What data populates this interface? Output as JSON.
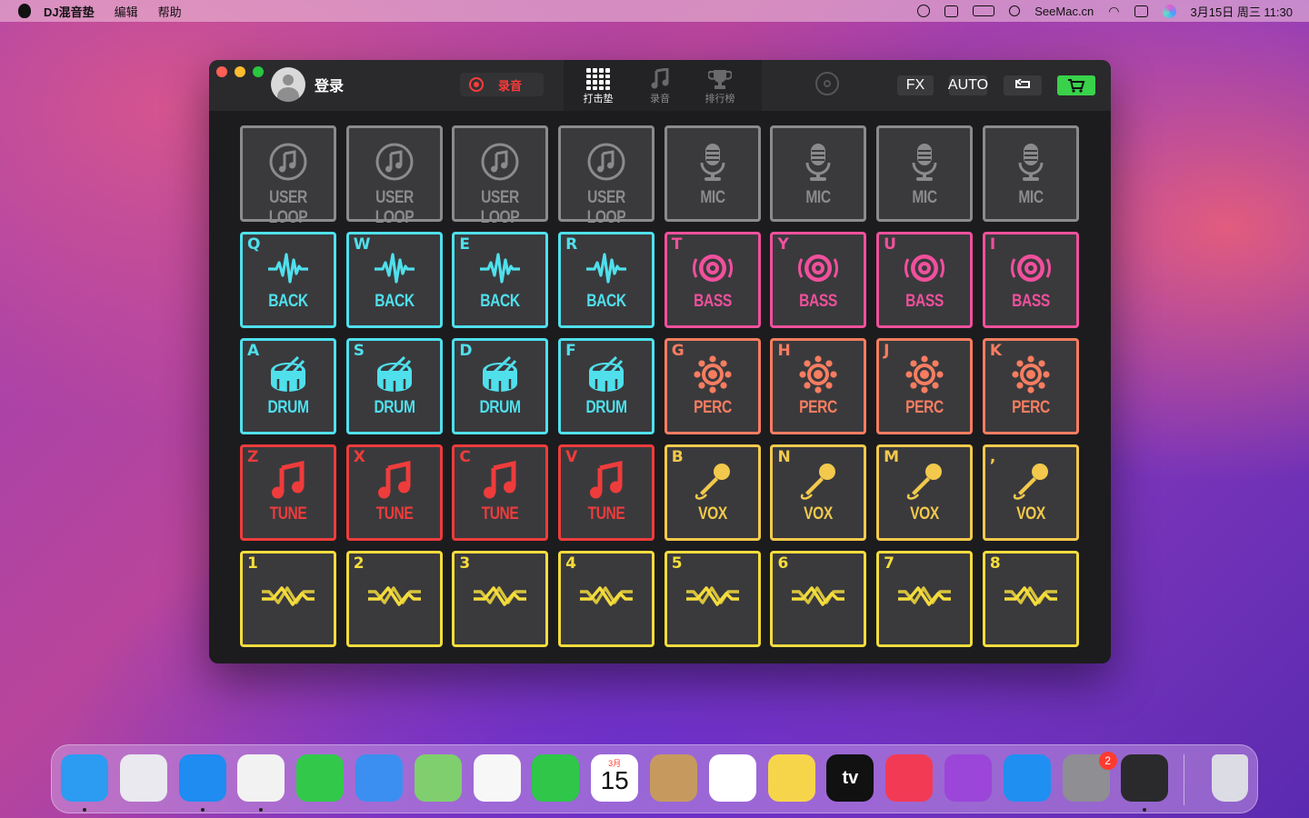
{
  "menubar": {
    "app_name": "DJ混音垫",
    "menus": [
      "编辑",
      "帮助"
    ],
    "site": "SeeMac.cn",
    "datetime": "3月15日 周三  11:30"
  },
  "window": {
    "user_label": "登录",
    "record_label": "录音",
    "tabs": [
      {
        "label": "打击垫",
        "icon": "grid-icon",
        "active": true
      },
      {
        "label": "录音",
        "icon": "music-note-icon",
        "active": false
      },
      {
        "label": "排行榜",
        "icon": "trophy-icon",
        "active": false
      }
    ],
    "fx_label": "FX",
    "auto_label": "AUTO",
    "undo_icon": "undo-icon",
    "cart_icon": "cart-icon"
  },
  "colors": {
    "grey": "#8b8b8e",
    "cyan": "#4fe0ec",
    "pink": "#f0509c",
    "orange": "#f77d60",
    "red": "#ee3c3c",
    "yellow": "#f2c94c",
    "gold": "#f4dc3c"
  },
  "pads": [
    {
      "key": "",
      "label": "USER LOOP",
      "icon": "music-circle-icon",
      "color": "grey"
    },
    {
      "key": "",
      "label": "USER LOOP",
      "icon": "music-circle-icon",
      "color": "grey"
    },
    {
      "key": "",
      "label": "USER LOOP",
      "icon": "music-circle-icon",
      "color": "grey"
    },
    {
      "key": "",
      "label": "USER LOOP",
      "icon": "music-circle-icon",
      "color": "grey"
    },
    {
      "key": "",
      "label": "MIC",
      "icon": "microphone-icon",
      "color": "grey"
    },
    {
      "key": "",
      "label": "MIC",
      "icon": "microphone-icon",
      "color": "grey"
    },
    {
      "key": "",
      "label": "MIC",
      "icon": "microphone-icon",
      "color": "grey"
    },
    {
      "key": "",
      "label": "MIC",
      "icon": "microphone-icon",
      "color": "grey"
    },
    {
      "key": "Q",
      "label": "BACK",
      "icon": "waveform-icon",
      "color": "cyan"
    },
    {
      "key": "W",
      "label": "BACK",
      "icon": "waveform-icon",
      "color": "cyan"
    },
    {
      "key": "E",
      "label": "BACK",
      "icon": "waveform-icon",
      "color": "cyan"
    },
    {
      "key": "R",
      "label": "BACK",
      "icon": "waveform-icon",
      "color": "cyan"
    },
    {
      "key": "T",
      "label": "BASS",
      "icon": "speaker-icon",
      "color": "pink"
    },
    {
      "key": "Y",
      "label": "BASS",
      "icon": "speaker-icon",
      "color": "pink"
    },
    {
      "key": "U",
      "label": "BASS",
      "icon": "speaker-icon",
      "color": "pink"
    },
    {
      "key": "I",
      "label": "BASS",
      "icon": "speaker-icon",
      "color": "pink"
    },
    {
      "key": "A",
      "label": "DRUM",
      "icon": "drum-icon",
      "color": "cyan"
    },
    {
      "key": "S",
      "label": "DRUM",
      "icon": "drum-icon",
      "color": "cyan"
    },
    {
      "key": "D",
      "label": "DRUM",
      "icon": "drum-icon",
      "color": "cyan"
    },
    {
      "key": "F",
      "label": "DRUM",
      "icon": "drum-icon",
      "color": "cyan"
    },
    {
      "key": "G",
      "label": "PERC",
      "icon": "tambourine-icon",
      "color": "orange"
    },
    {
      "key": "H",
      "label": "PERC",
      "icon": "tambourine-icon",
      "color": "orange"
    },
    {
      "key": "J",
      "label": "PERC",
      "icon": "tambourine-icon",
      "color": "orange"
    },
    {
      "key": "K",
      "label": "PERC",
      "icon": "tambourine-icon",
      "color": "orange"
    },
    {
      "key": "Z",
      "label": "TUNE",
      "icon": "music-note-icon",
      "color": "red"
    },
    {
      "key": "X",
      "label": "TUNE",
      "icon": "music-note-icon",
      "color": "red"
    },
    {
      "key": "C",
      "label": "TUNE",
      "icon": "music-note-icon",
      "color": "red"
    },
    {
      "key": "V",
      "label": "TUNE",
      "icon": "music-note-icon",
      "color": "red"
    },
    {
      "key": "B",
      "label": "VOX",
      "icon": "handheld-mic-icon",
      "color": "yellow"
    },
    {
      "key": "N",
      "label": "VOX",
      "icon": "handheld-mic-icon",
      "color": "yellow"
    },
    {
      "key": "M",
      "label": "VOX",
      "icon": "handheld-mic-icon",
      "color": "yellow"
    },
    {
      "key": ",",
      "label": "VOX",
      "icon": "handheld-mic-icon",
      "color": "yellow"
    },
    {
      "key": "1",
      "label": "",
      "icon": "loop-wave-icon",
      "color": "gold"
    },
    {
      "key": "2",
      "label": "",
      "icon": "loop-wave-icon",
      "color": "gold"
    },
    {
      "key": "3",
      "label": "",
      "icon": "loop-wave-icon",
      "color": "gold"
    },
    {
      "key": "4",
      "label": "",
      "icon": "loop-wave-icon",
      "color": "gold"
    },
    {
      "key": "5",
      "label": "",
      "icon": "loop-wave-icon",
      "color": "gold"
    },
    {
      "key": "6",
      "label": "",
      "icon": "loop-wave-icon",
      "color": "gold"
    },
    {
      "key": "7",
      "label": "",
      "icon": "loop-wave-icon",
      "color": "gold"
    },
    {
      "key": "8",
      "label": "",
      "icon": "loop-wave-icon",
      "color": "gold"
    }
  ],
  "dock": {
    "apps": [
      {
        "name": "finder-icon",
        "color": "#2b9cf2",
        "running": true
      },
      {
        "name": "launchpad-icon",
        "color": "#e9e9ef",
        "running": false
      },
      {
        "name": "safari-icon",
        "color": "#1e8cf0",
        "running": true
      },
      {
        "name": "chrome-icon",
        "color": "#f2f2f2",
        "running": true
      },
      {
        "name": "messages-icon",
        "color": "#32c94b",
        "running": false
      },
      {
        "name": "mail-icon",
        "color": "#3b8ff0",
        "running": false
      },
      {
        "name": "maps-icon",
        "color": "#7fcf6e",
        "running": false
      },
      {
        "name": "photos-icon",
        "color": "#f7f7f7",
        "running": false
      },
      {
        "name": "facetime-icon",
        "color": "#2fc64a",
        "running": false
      },
      {
        "name": "calendar-icon",
        "color": "#ffffff",
        "running": false
      },
      {
        "name": "contacts-icon",
        "color": "#c69a5f",
        "running": false
      },
      {
        "name": "reminders-icon",
        "color": "#ffffff",
        "running": false
      },
      {
        "name": "notes-icon",
        "color": "#f7d54a",
        "running": false
      },
      {
        "name": "appletv-icon",
        "color": "#111111",
        "running": false
      },
      {
        "name": "music-icon",
        "color": "#f23a55",
        "running": false
      },
      {
        "name": "podcasts-icon",
        "color": "#9b45d9",
        "running": false
      },
      {
        "name": "appstore-icon",
        "color": "#1f8ff2",
        "running": false
      },
      {
        "name": "system-preferences-icon",
        "color": "#8e8e93",
        "running": false
      },
      {
        "name": "dj-mix-pad-icon",
        "color": "#2a2a2c",
        "running": true
      },
      {
        "name": "trash-icon",
        "color": "#dcdce4",
        "running": false
      }
    ],
    "calendar": {
      "month": "3月",
      "day": "15"
    },
    "system_preferences_badge": "2",
    "appletv_label": "tv"
  }
}
